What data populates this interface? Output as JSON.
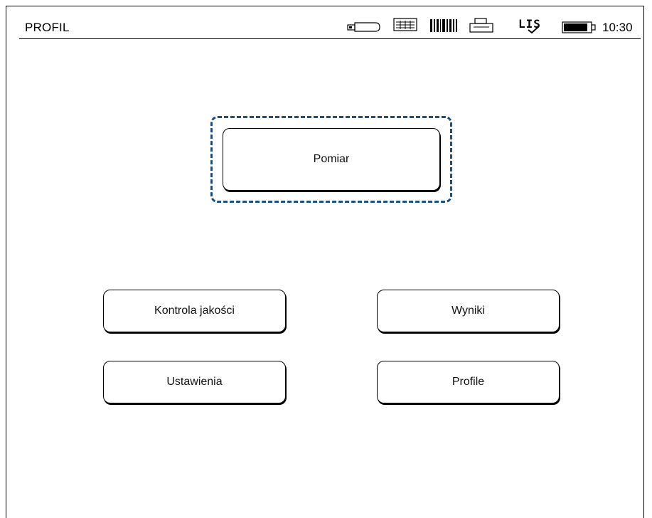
{
  "header": {
    "title": "PROFIL",
    "time": "10:30",
    "lis_label": "LIS",
    "status_icons": [
      "usb-stick-icon",
      "keyboard-icon",
      "barcode-scanner-icon",
      "printer-icon",
      "lis-connected-icon",
      "battery-icon"
    ]
  },
  "main_menu": {
    "primary_button": "Pomiar",
    "buttons": {
      "quality_control": "Kontrola jakości",
      "results": "Wyniki",
      "settings": "Ustawienia",
      "profiles": "Profile"
    }
  },
  "colors": {
    "focus_ring": "#1f4e79",
    "foreground": "#000000",
    "background": "#ffffff"
  }
}
